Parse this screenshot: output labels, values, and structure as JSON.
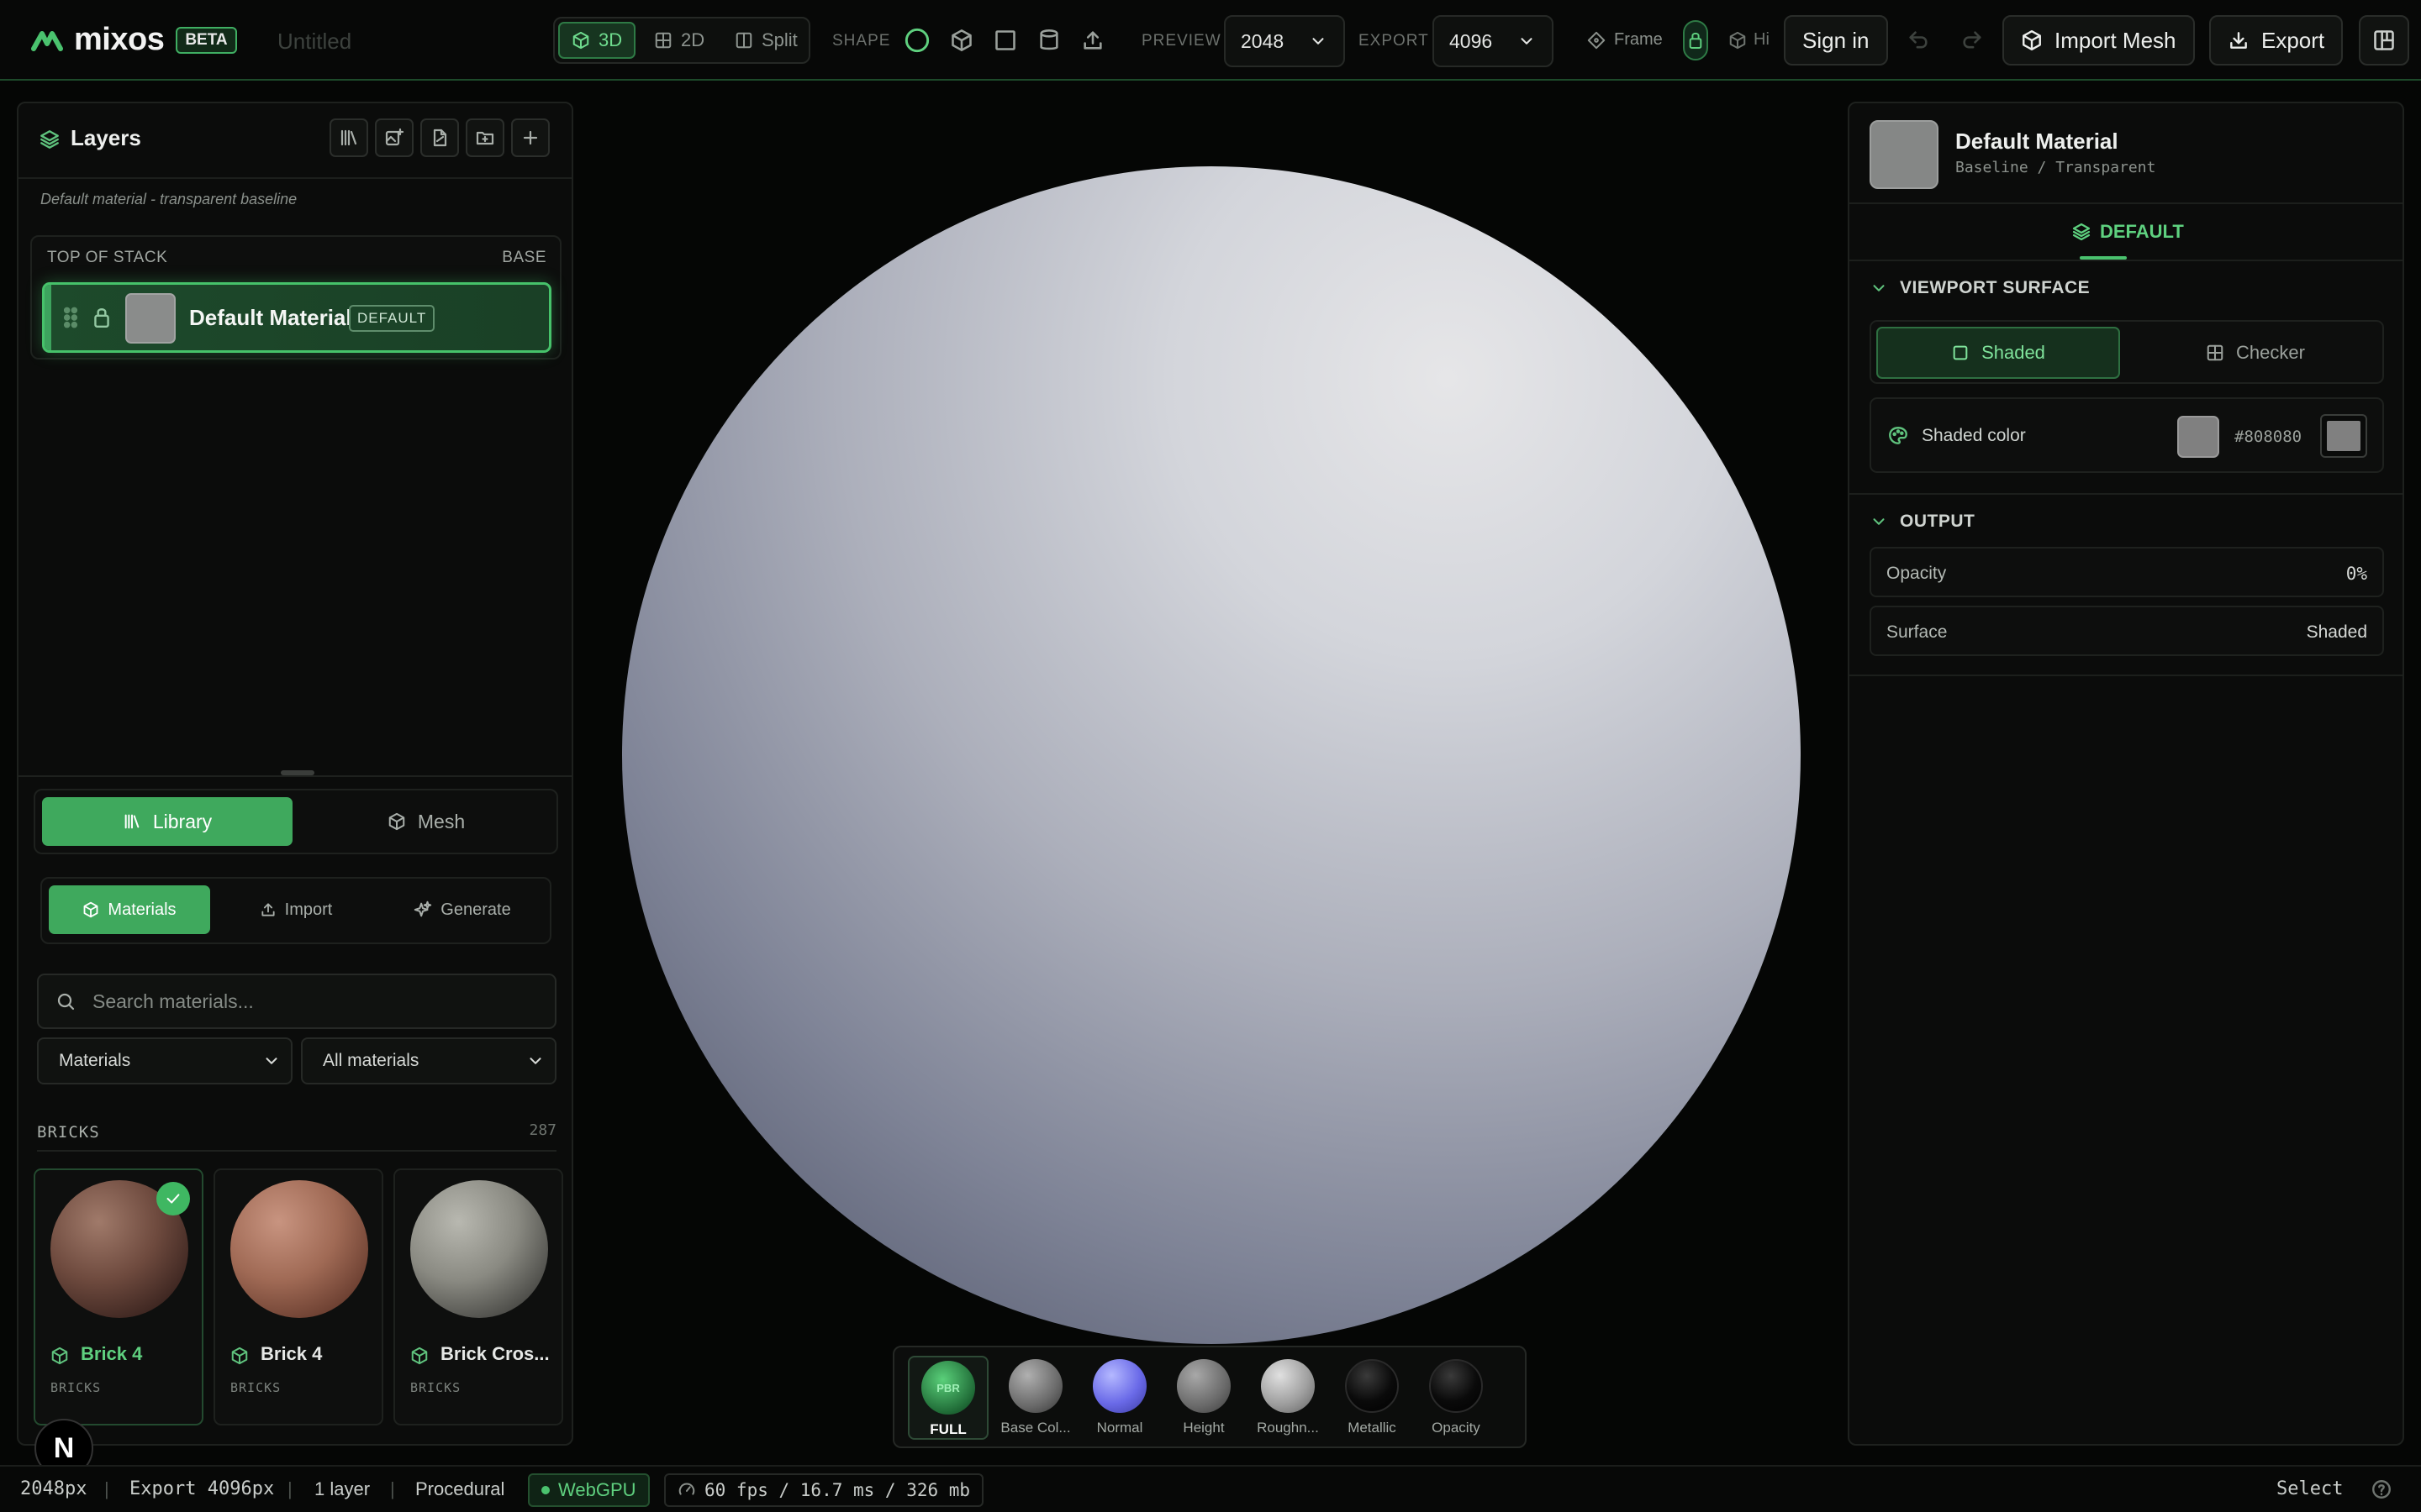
{
  "app": {
    "name": "mixos",
    "badge": "BETA",
    "doc_title": "Untitled"
  },
  "toolbar": {
    "view_modes": [
      {
        "label": "3D",
        "active": true
      },
      {
        "label": "2D",
        "active": false
      },
      {
        "label": "Split",
        "active": false
      }
    ],
    "shape_label": "SHAPE",
    "shapes": [
      "sphere-icon",
      "cube-icon",
      "plane-icon",
      "cylinder-icon",
      "upload-mesh-icon"
    ],
    "preview_label": "PREVIEW",
    "preview_value": "2048",
    "export_label": "EXPORT",
    "export_value": "4096",
    "frame_label": "Frame",
    "hide_label": "Hi",
    "sign_in": "Sign in",
    "import_mesh": "Import Mesh",
    "export_btn": "Export"
  },
  "layers": {
    "title": "Layers",
    "subtitle": "Default material - transparent baseline",
    "stack_top": "TOP OF STACK",
    "stack_base": "BASE",
    "items": [
      {
        "name": "Default Material",
        "badge": "DEFAULT",
        "swatch": "#8a8c8b"
      }
    ]
  },
  "library": {
    "tabs": [
      "Library",
      "Mesh"
    ],
    "subtabs": [
      "Materials",
      "Import",
      "Generate"
    ],
    "search_placeholder": "Search materials...",
    "filter_type": "Materials",
    "filter_scope": "All materials",
    "category": {
      "name": "BRICKS",
      "count": "287"
    },
    "cards": [
      {
        "name": "Brick 4",
        "category": "BRICKS",
        "selected": true
      },
      {
        "name": "Brick 4",
        "category": "BRICKS",
        "selected": false
      },
      {
        "name": "Brick Cros...",
        "category": "BRICKS",
        "selected": false
      }
    ]
  },
  "viewport": {
    "maps": [
      {
        "label": "FULL",
        "active": true,
        "orb_text": "PBR"
      },
      {
        "label": "Base Col...",
        "active": false
      },
      {
        "label": "Normal",
        "active": false
      },
      {
        "label": "Height",
        "active": false
      },
      {
        "label": "Roughn...",
        "active": false
      },
      {
        "label": "Metallic",
        "active": false
      },
      {
        "label": "Opacity",
        "active": false
      }
    ]
  },
  "properties": {
    "title": "Default Material",
    "subtitle": "Baseline / Transparent",
    "tab": "DEFAULT",
    "viewport_surface": {
      "heading": "VIEWPORT SURFACE",
      "modes": [
        "Shaded",
        "Checker"
      ],
      "active": "Shaded"
    },
    "shaded_color": {
      "label": "Shaded color",
      "hex": "#808080"
    },
    "output": {
      "heading": "OUTPUT",
      "rows": [
        {
          "label": "Opacity",
          "value": "0%"
        },
        {
          "label": "Surface",
          "value": "Shaded"
        }
      ]
    }
  },
  "status": {
    "resolution": "2048px",
    "export": "Export 4096px",
    "layers": "1 layer",
    "mode": "Procedural",
    "backend": "WebGPU",
    "perf": "60 fps / 16.7 ms / 326 mb",
    "tool": "Select"
  },
  "colors": {
    "accent": "#46c26a",
    "background": "#050605"
  }
}
